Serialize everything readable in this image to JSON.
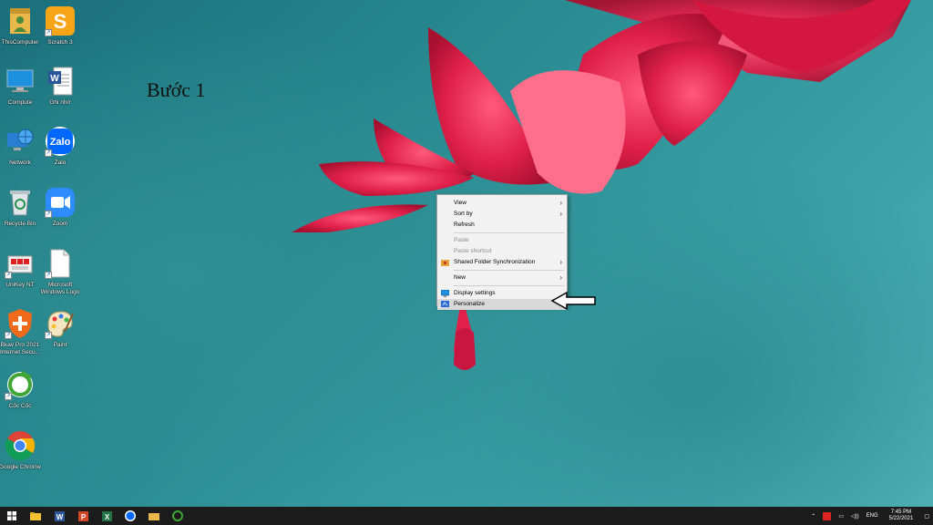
{
  "desktop": {
    "caption": "Bước 1",
    "icons": [
      {
        "label": "ThisComputer",
        "icon": "user-folder-icon"
      },
      {
        "label": "Scratch 3",
        "icon": "scratch-icon"
      },
      {
        "label": "Compute",
        "icon": "computer-icon"
      },
      {
        "label": "Ghi nhớ",
        "icon": "word-doc-icon"
      },
      {
        "label": "Network",
        "icon": "network-icon"
      },
      {
        "label": "Zalo",
        "icon": "zalo-icon"
      },
      {
        "label": "Recycle Bin",
        "icon": "recycle-bin-icon"
      },
      {
        "label": "Zoom",
        "icon": "zoom-icon"
      },
      {
        "label": "UniKey NT",
        "icon": "unikey-icon"
      },
      {
        "label": "Microsoft Windows Logo",
        "icon": "blank-file-icon"
      },
      {
        "label": "Bkav Pro 2021 Internet Secu...",
        "icon": "bkav-icon"
      },
      {
        "label": "Paint",
        "icon": "paint-icon"
      },
      {
        "label": "Cốc Cốc",
        "icon": "coccoc-icon"
      },
      {
        "label": "Google Chrome",
        "icon": "chrome-icon"
      }
    ]
  },
  "context_menu": {
    "items": {
      "view": "View",
      "sort_by": "Sort by",
      "refresh": "Refresh",
      "paste": "Paste",
      "paste_shortcut": "Paste shortcut",
      "shared_folder": "Shared Folder Synchronization",
      "new": "New",
      "display_settings": "Display settings",
      "personalize": "Personalize"
    }
  },
  "taskbar": {
    "language": "ENG",
    "time": "7:45 PM",
    "date": "5/22/2021"
  },
  "colors": {
    "menu_bg": "#f2f2f2",
    "taskbar_bg": "#1c1c1c",
    "flower": "#e0204a"
  }
}
